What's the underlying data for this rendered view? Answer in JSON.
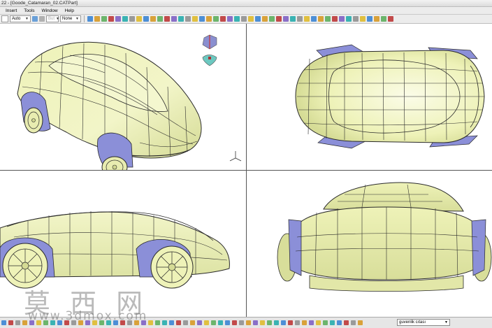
{
  "window": {
    "title": "22 - [Goode_Catamaran_02.CATPart]"
  },
  "menu": {
    "items": [
      "Insert",
      "Tools",
      "Window",
      "Help"
    ]
  },
  "toolbar": {
    "combo1": "",
    "combo2": "Auto",
    "combo3": "But",
    "combo4": "None"
  },
  "statusbar": {
    "selector_value": "guvenlik cıtası"
  },
  "watermark": {
    "chinese": "莫 西 网",
    "url": "www.3dmox.com"
  },
  "colors": {
    "surface": "#f0f4c0",
    "surface_shade": "#d8de9a",
    "wheel_arch": "#8b8fd8",
    "lines": "#2a2a2a",
    "compass_top": "#8a8fd0",
    "compass_bottom": "#6cc8c0"
  }
}
